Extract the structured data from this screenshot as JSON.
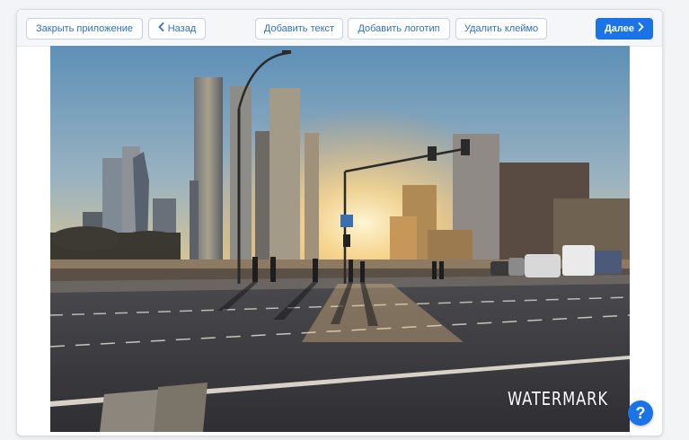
{
  "toolbar": {
    "close_app_label": "Закрыть приложение",
    "back_label": "Назад",
    "add_text_label": "Добавить текст",
    "add_logo_label": "Добавить логотип",
    "remove_watermark_label": "Удалить клеймо",
    "next_label": "Далее"
  },
  "image": {
    "description_icon": "photo-city-sunset",
    "watermark_text": "WATERMARK"
  },
  "help": {
    "label": "?"
  },
  "colors": {
    "accent": "#1b73e8",
    "button_text": "#2f6fc4"
  },
  "icons": {
    "back": "chevron-left-icon",
    "next": "chevron-right-icon",
    "help": "question-icon"
  }
}
